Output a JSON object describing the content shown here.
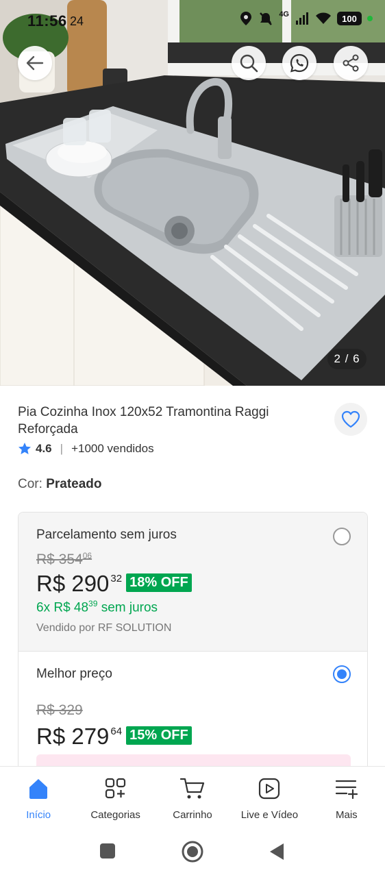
{
  "status_bar": {
    "time": "11:56",
    "date": "24",
    "network": "4G",
    "battery": "100"
  },
  "hero": {
    "image_counter": "2 / 6",
    "buttons": {
      "back": "back-arrow-icon",
      "search": "search-icon",
      "whatsapp": "whatsapp-icon",
      "share": "share-icon"
    }
  },
  "product": {
    "title": "Pia Cozinha Inox 120x52 Tramontina Raggi Reforçada",
    "rating": "4.6",
    "sold": "+1000 vendidos",
    "color_label": "Cor:",
    "color_value": "Prateado"
  },
  "offers": [
    {
      "title": "Parcelamento sem juros",
      "selected": false,
      "old_price_main": "R$ 354",
      "old_price_cents": "06",
      "price_main": "R$ 290",
      "price_cents": "32",
      "discount": "18% OFF",
      "installments_prefix": "6x R$ 48",
      "installments_cents": "39",
      "installments_suffix": "sem juros",
      "seller": "Vendido por RF SOLUTION"
    },
    {
      "title": "Melhor preço",
      "selected": true,
      "old_price_main": "R$ 329",
      "price_main": "R$ 279",
      "price_cents": "64",
      "discount": "15% OFF"
    }
  ],
  "bottom_nav": [
    {
      "label": "Início",
      "icon": "home-icon",
      "active": true
    },
    {
      "label": "Categorias",
      "icon": "categories-icon",
      "active": false
    },
    {
      "label": "Carrinho",
      "icon": "cart-icon",
      "active": false
    },
    {
      "label": "Live e Vídeo",
      "icon": "play-video-icon",
      "active": false
    },
    {
      "label": "Mais",
      "icon": "menu-plus-icon",
      "active": false
    }
  ],
  "colors": {
    "accent_blue": "#3483fa",
    "discount_green": "#00a650"
  }
}
